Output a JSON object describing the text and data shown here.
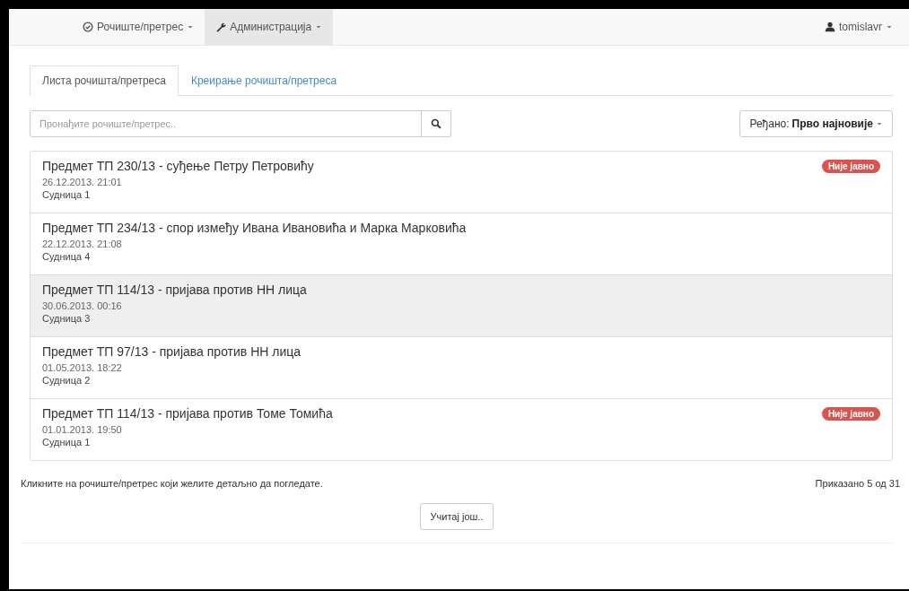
{
  "navbar": {
    "menus": [
      {
        "label": "Рочиште/претрес",
        "selected": false
      },
      {
        "label": "Администрација",
        "selected": true
      }
    ],
    "user": {
      "label": "tomislavr"
    }
  },
  "tabs": [
    {
      "label": "Листа рочишта/претреса",
      "selected": true
    },
    {
      "label": "Креирање рочишта/претреса",
      "selected": false
    }
  ],
  "search": {
    "placeholder": "Пронађите рочиште/претрес.."
  },
  "sort": {
    "label": "Ређано:",
    "value": "Прво најновије"
  },
  "hearings": [
    {
      "title": "Предмет ТП 230/13 - суђење Петру Петровићу",
      "date": "26.12.2013. 21:01",
      "room": "Судница 1",
      "badge": "Није јавно",
      "highlighted": false
    },
    {
      "title": "Предмет ТП 234/13 - спор између Ивана Ивановића и Марка Марковића",
      "date": "22.12.2013. 21:08",
      "room": "Судница 4",
      "highlighted": false
    },
    {
      "title": "Предмет ТП 114/13 - пријава против НН лица",
      "date": "30.06.2013. 00:16",
      "room": "Судница 3",
      "highlighted": true
    },
    {
      "title": "Предмет ТП 97/13 - пријава против НН лица",
      "date": "01.05.2013. 18:22",
      "room": "Судница 2",
      "highlighted": false
    },
    {
      "title": "Предмет ТП 114/13 - пријава против Томе Томића",
      "date": "01.01.2013. 19:50",
      "room": "Судница 1",
      "badge": "Није јавно",
      "highlighted": false
    }
  ],
  "hint": "Кликните на рочиште/претрес који желите детаљно да погледате.",
  "count": "Приказано 5 од 31",
  "load_more": "Учитај још.."
}
